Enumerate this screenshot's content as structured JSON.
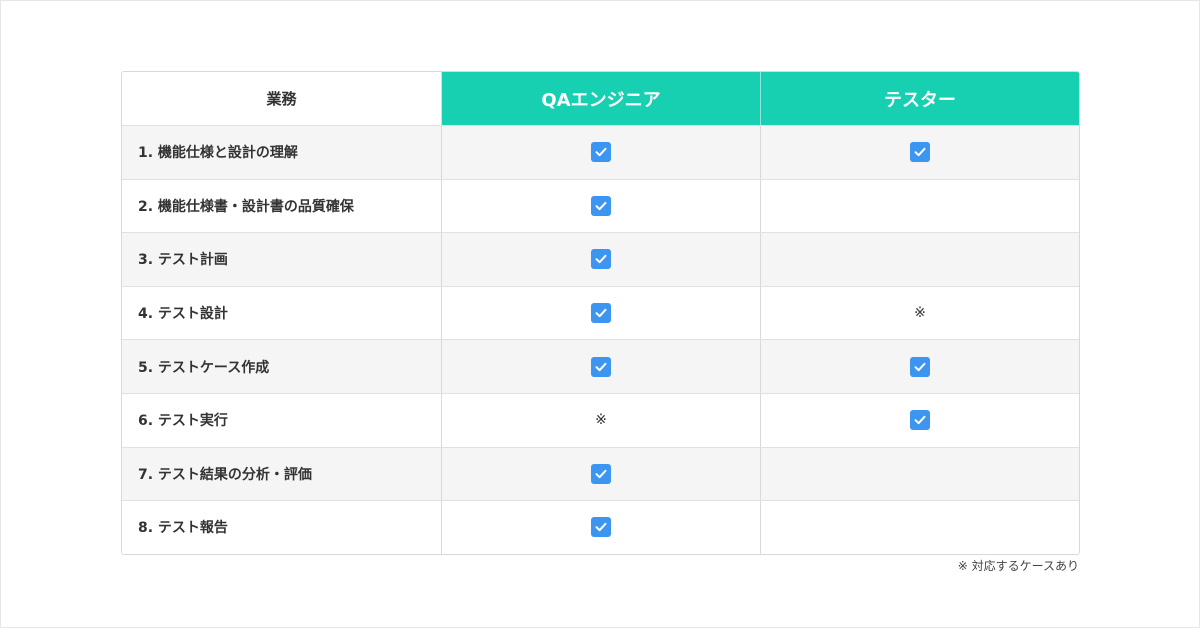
{
  "table": {
    "headers": [
      "業務",
      "QAエンジニア",
      "テスター"
    ],
    "rows": [
      {
        "task": "1. 機能仕様と設計の理解",
        "qa": "check",
        "tester": "check"
      },
      {
        "task": "2. 機能仕様書・設計書の品質確保",
        "qa": "check",
        "tester": "none"
      },
      {
        "task": "3. テスト計画",
        "qa": "check",
        "tester": "none"
      },
      {
        "task": "4. テスト設計",
        "qa": "check",
        "tester": "※"
      },
      {
        "task": "5. テストケース作成",
        "qa": "check",
        "tester": "check"
      },
      {
        "task": "6. テスト実行",
        "qa": "※",
        "tester": "check"
      },
      {
        "task": "7. テスト結果の分析・評価",
        "qa": "check",
        "tester": "none"
      },
      {
        "task": "8. テスト報告",
        "qa": "check",
        "tester": "none"
      }
    ]
  },
  "note": "※ 対応するケースあり",
  "colors": {
    "header_accent": "#17cfb1",
    "checkbox": "#3d95f2"
  },
  "icons": {
    "check": "checkbox-checked-icon"
  }
}
